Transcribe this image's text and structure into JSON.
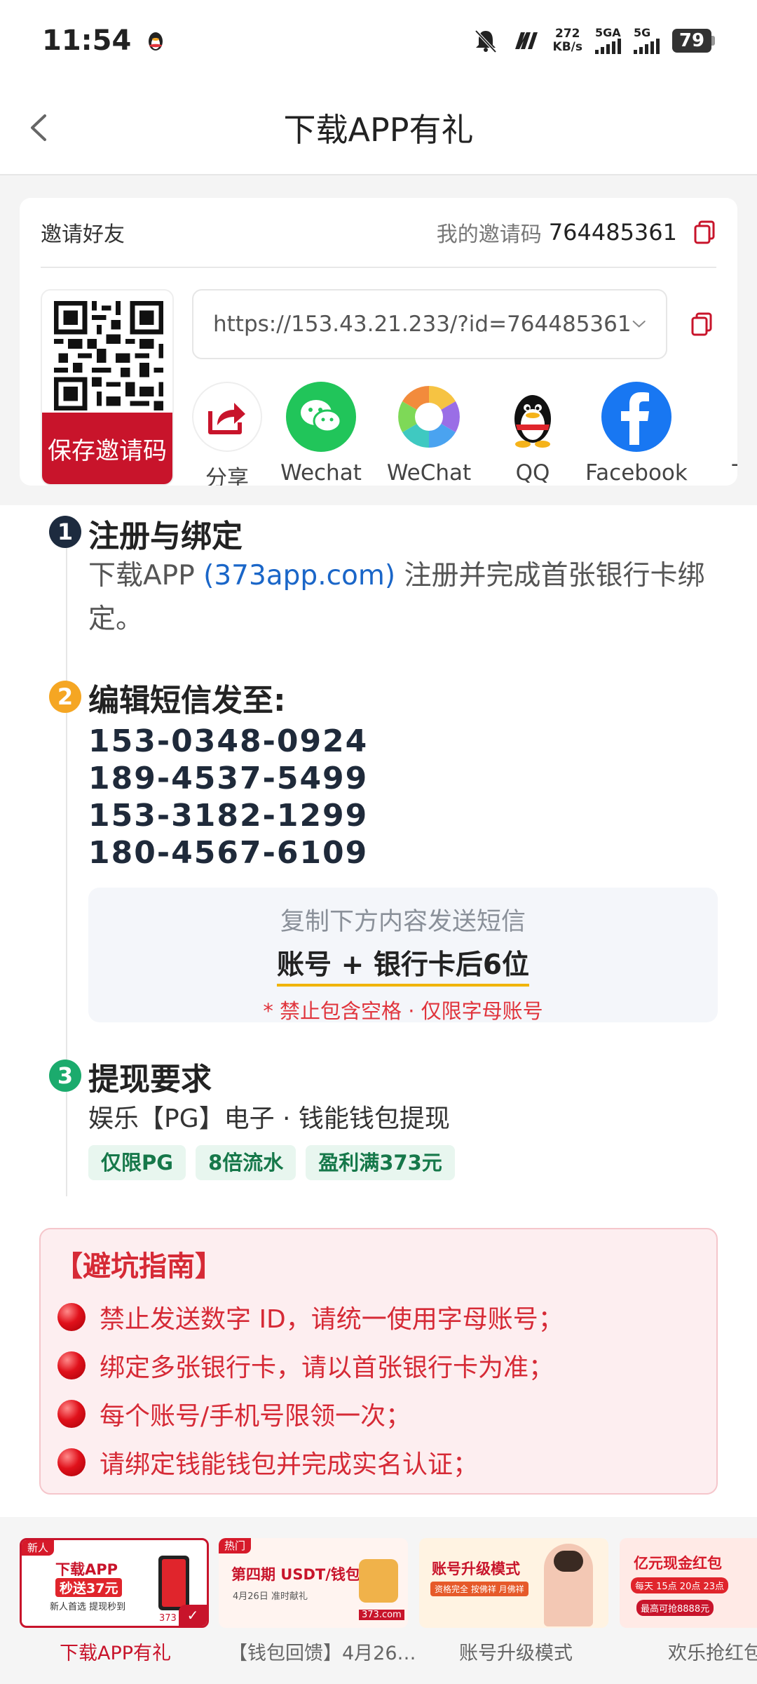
{
  "status_bar": {
    "time": "11:54",
    "speed_value": "272",
    "speed_unit": "KB/s",
    "net1": "5GA",
    "net2": "5G",
    "battery": "79"
  },
  "header": {
    "title": "下载APP有礼"
  },
  "invite": {
    "title": "邀请好友",
    "my_code_label": "我的邀请码",
    "my_code_value": "764485361",
    "save_qr": "保存邀请码",
    "url": "https://153.43.21.233/?id=764485361",
    "share": [
      {
        "label": "分享",
        "icon": "share-icon"
      },
      {
        "label": "Wechat",
        "icon": "wechat-icon"
      },
      {
        "label": "WeChat",
        "icon": "wechat-moments-icon"
      },
      {
        "label": "QQ",
        "icon": "qq-icon"
      },
      {
        "label": "Facebook",
        "icon": "facebook-icon"
      },
      {
        "label": "T",
        "icon": "more-share-icon"
      }
    ]
  },
  "steps": {
    "s1": {
      "num": "1",
      "title": "注册与绑定",
      "desc_pre": "下载APP ",
      "desc_link": "(373app.com)",
      "desc_post": " 注册并完成首张银行卡绑定。"
    },
    "s2": {
      "num": "2",
      "title": "编辑短信发至:",
      "phones": [
        "153-0348-0924",
        "189-4537-5499",
        "153-3182-1299",
        "180-4567-6109"
      ],
      "sms_hint": "复制下方内容发送短信",
      "sms_content": "账号 + 银行卡后6位",
      "sms_warning": "* 禁止包含空格 · 仅限字母账号"
    },
    "s3": {
      "num": "3",
      "title": "提现要求",
      "desc": "娱乐【PG】电子 · 钱能钱包提现",
      "tags": [
        "仅限PG",
        "8倍流水",
        "盈利满373元"
      ]
    }
  },
  "warning": {
    "title": "【避坑指南】",
    "items": [
      "禁止发送数字 ID，请统一使用字母账号；",
      "绑定多张银行卡，请以首张银行卡为准；",
      "每个账号/手机号限领一次；",
      "请绑定钱能钱包并完成实名认证；"
    ]
  },
  "bottom_tabs": [
    {
      "label": "下载APP有礼",
      "tag": "新人",
      "line1": "下载APP",
      "line2": "秒送37元",
      "line3": "新人首选 提现秒到",
      "badge": "373"
    },
    {
      "label": "【钱包回馈】4月26…",
      "tag": "热门",
      "line1": "第四期 USDT/钱包",
      "line2": "4月26日 准时献礼",
      "badge": "373.com"
    },
    {
      "label": "账号升级模式",
      "line1": "账号升级模式",
      "line2": "资格完全 按佛祥 月佛祥"
    },
    {
      "label": "欢乐抢红包",
      "line1": "亿元现金红包",
      "line2": "每天 15点 20点 23点",
      "line3": "最高可抢8888元"
    }
  ],
  "colors": {
    "accent_red": "#c8142b",
    "link_blue": "#1a66c8",
    "step1": "#1d2b3f",
    "step2": "#f5a623",
    "step3": "#1bab6d"
  }
}
